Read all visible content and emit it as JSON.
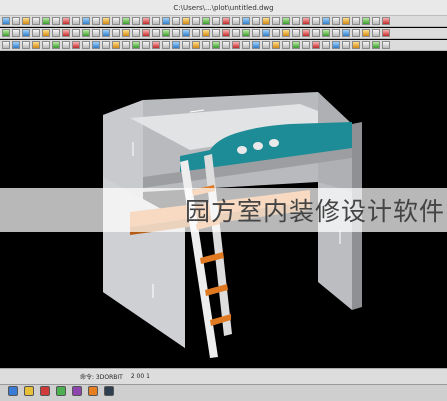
{
  "window": {
    "title": "C:\\Users\\...\\plot\\untitled.dwg"
  },
  "command_line": {
    "prompt": "命令: 3DORBIT",
    "coords": "2 00 1"
  },
  "watermark": {
    "text": "园方室内装修设计软件"
  },
  "colors": {
    "background": "#000000",
    "panel_light": "#d7d8db",
    "panel_side": "#a7a9ad",
    "guard_teal": "#1e8c96",
    "desk_orange": "#e07a22",
    "ladder_white": "#eeeeee"
  },
  "icons": [
    "toolbar-button-icon",
    "bed-model-icon"
  ]
}
